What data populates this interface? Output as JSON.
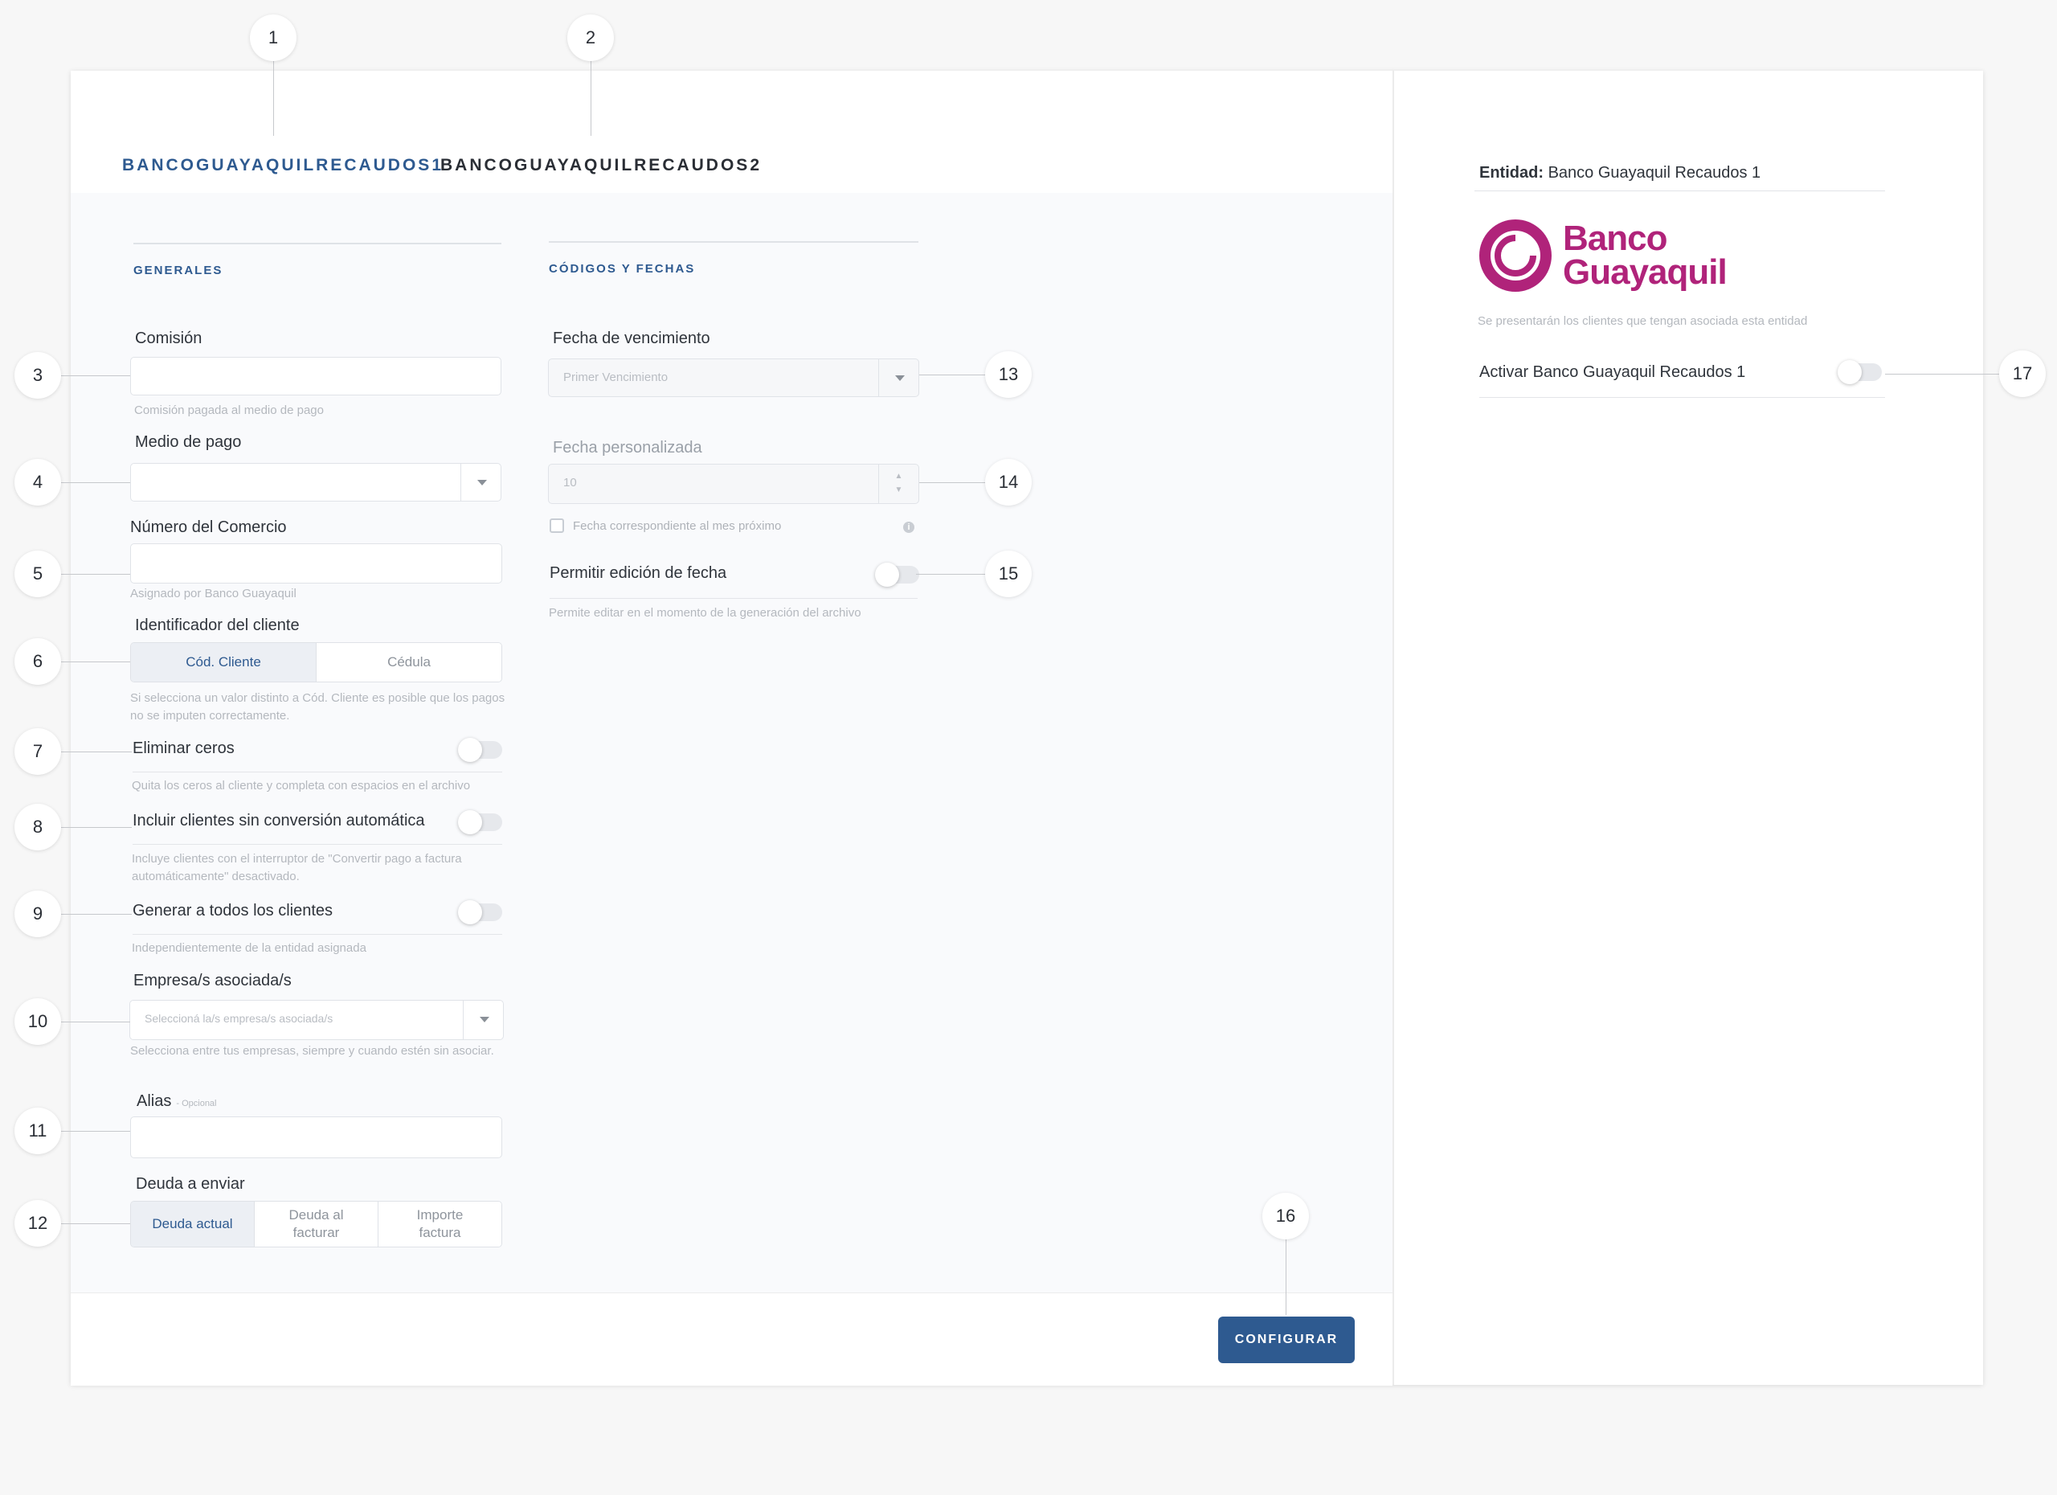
{
  "tabs": [
    {
      "label": "BANCOGUAYAQUILRECAUDOS1",
      "active": true
    },
    {
      "label": "BANCOGUAYAQUILRECAUDOS2",
      "active": false
    }
  ],
  "generales": {
    "title": "GENERALES",
    "comision": {
      "label": "Comisión",
      "hint": "Comisión pagada al medio de pago",
      "value": ""
    },
    "medio_pago": {
      "label": "Medio de pago",
      "value": ""
    },
    "numero_comercio": {
      "label": "Número del Comercio",
      "hint": "Asignado por Banco Guayaquil",
      "value": ""
    },
    "identificador": {
      "label": "Identificador del cliente",
      "options": [
        "Cód. Cliente",
        "Cédula"
      ],
      "selected": "Cód. Cliente",
      "hint": "Si selecciona un valor distinto a Cód. Cliente es posible que los pagos no se imputen correctamente."
    },
    "eliminar_ceros": {
      "label": "Eliminar ceros",
      "hint": "Quita los ceros al cliente y completa con espacios en el archivo",
      "on": false
    },
    "incluir_clientes": {
      "label": "Incluir clientes sin conversión automática",
      "hint": "Incluye clientes con el interruptor de \"Convertir pago a factura automáticamente\" desactivado.",
      "on": false
    },
    "generar_todos": {
      "label": "Generar a todos los clientes",
      "hint": "Independientemente de la entidad asignada",
      "on": false
    },
    "empresas": {
      "label": "Empresa/s asociada/s",
      "placeholder": "Seleccioná la/s empresa/s asociada/s",
      "hint": "Selecciona entre tus empresas, siempre y cuando estén sin asociar."
    },
    "alias": {
      "label": "Alias",
      "optional": "- Opcional",
      "value": ""
    },
    "deuda": {
      "label": "Deuda a enviar",
      "options": [
        "Deuda actual",
        "Deuda al facturar",
        "Importe factura"
      ],
      "selected": "Deuda actual"
    }
  },
  "codigos": {
    "title": "CÓDIGOS Y FECHAS",
    "fecha_vencimiento": {
      "label": "Fecha de vencimiento",
      "placeholder": "Primer Vencimiento"
    },
    "fecha_personalizada": {
      "label": "Fecha personalizada",
      "placeholder": "10"
    },
    "checkbox_label": "Fecha correspondiente al mes próximo",
    "permitir_edicion": {
      "label": "Permitir edición de fecha",
      "hint": "Permite editar en el momento de la generación del archivo",
      "on": false
    }
  },
  "footer": {
    "configure_label": "CONFIGURAR"
  },
  "sidebar": {
    "entity_label": "Entidad:",
    "entity_value": "Banco Guayaquil Recaudos 1",
    "logo_line1": "Banco",
    "logo_line2": "Guayaquil",
    "description": "Se presentarán los clientes que tengan asociada esta entidad",
    "activate_label": "Activar Banco Guayaquil Recaudos 1",
    "activate_on": false
  },
  "markers": [
    "1",
    "2",
    "3",
    "4",
    "5",
    "6",
    "7",
    "8",
    "9",
    "10",
    "11",
    "12",
    "13",
    "14",
    "15",
    "16",
    "17"
  ],
  "colors": {
    "primary": "#2e5a90",
    "brand": "#b0237a"
  }
}
